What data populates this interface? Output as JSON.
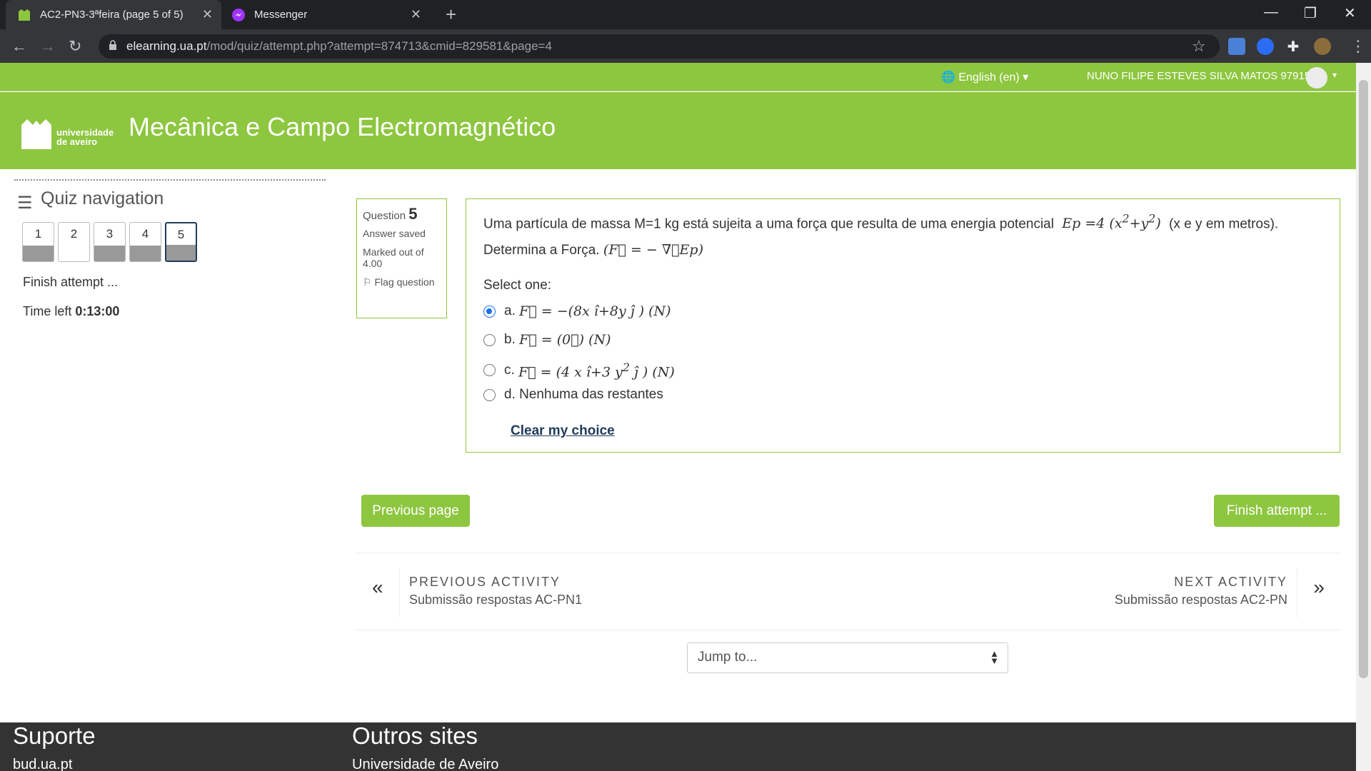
{
  "browser": {
    "tabs": [
      {
        "title": "AC2-PN3-3ªfeira (page 5 of 5)",
        "active": true
      },
      {
        "title": "Messenger",
        "active": false
      }
    ],
    "url_host": "elearning.ua.pt",
    "url_path": "/mod/quiz/attempt.php?attempt=874713&cmid=829581&page=4"
  },
  "topnav": {
    "language": "English (en)",
    "user": "NUNO FILIPE ESTEVES SILVA MATOS 97915"
  },
  "header": {
    "logo_text_1": "universidade",
    "logo_text_2": "de aveiro",
    "course_title": "Mecânica e Campo Electromagnético"
  },
  "quiz_nav": {
    "title": "Quiz navigation",
    "questions": [
      "1",
      "2",
      "3",
      "4",
      "5"
    ],
    "finish": "Finish attempt ...",
    "time_label": "Time left",
    "time_value": "0:13:00"
  },
  "question": {
    "label": "Question",
    "number": "5",
    "status": "Answer saved",
    "marked": "Marked out of 4.00",
    "flag": "Flag question",
    "text_1": "Uma partícula de massa M=1 kg está sujeita a uma força que resulta de uma energia potencial",
    "text_2": "(x e y em metros).",
    "text_3": "Determina a Força.",
    "select": "Select one:",
    "options": [
      {
        "letter": "a."
      },
      {
        "letter": "b."
      },
      {
        "letter": "c."
      },
      {
        "letter": "d.",
        "text": "Nenhuma das restantes"
      }
    ],
    "clear": "Clear my choice"
  },
  "buttons": {
    "previous": "Previous page",
    "finish": "Finish attempt ..."
  },
  "activity_nav": {
    "prev_label": "PREVIOUS ACTIVITY",
    "prev_name": "Submissão respostas AC-PN1",
    "next_label": "NEXT ACTIVITY",
    "next_name": "Submissão respostas AC2-PN"
  },
  "jump": {
    "label": "Jump to..."
  },
  "footer": {
    "support_title": "Suporte",
    "support_link": "bud.ua.pt",
    "other_title": "Outros sites",
    "other_link": "Universidade de Aveiro"
  }
}
